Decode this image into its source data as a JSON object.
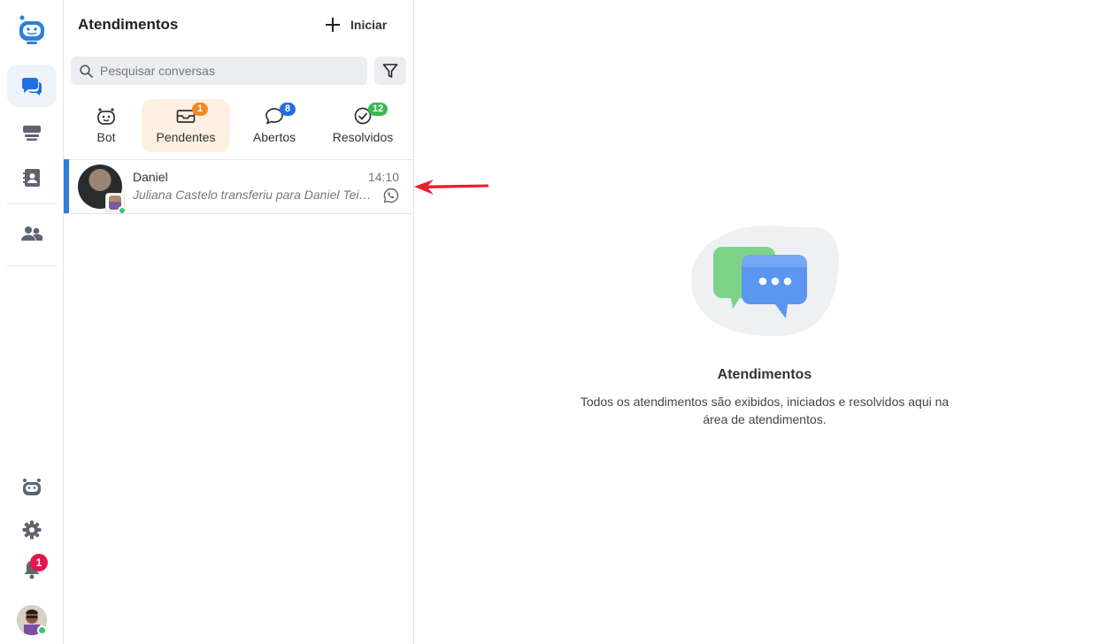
{
  "rail": {
    "items": [
      {
        "name": "bot-logo",
        "icon": "robot-face-icon"
      },
      {
        "name": "chats",
        "icon": "chat-bubbles-icon",
        "active": true
      },
      {
        "name": "queues",
        "icon": "stack-icon"
      },
      {
        "name": "contacts",
        "icon": "contact-book-icon"
      },
      {
        "name": "team",
        "icon": "people-icon"
      },
      {
        "name": "bot-settings",
        "icon": "robot-icon"
      },
      {
        "name": "settings",
        "icon": "gear-icon"
      },
      {
        "name": "notifications",
        "icon": "bell-icon"
      }
    ],
    "notifications_count": "1",
    "accent": "#2d7fdc"
  },
  "panel": {
    "title": "Atendimentos",
    "start_label": "Iniciar",
    "search_placeholder": "Pesquisar conversas"
  },
  "tabs": [
    {
      "label": "Bot",
      "badge": "",
      "icon": "robot-face-icon"
    },
    {
      "label": "Pendentes",
      "badge": "1",
      "badge_color": "#f08a24",
      "icon": "envelope-icon",
      "active": true
    },
    {
      "label": "Abertos",
      "badge": "8",
      "badge_color": "#1f6fe0",
      "icon": "chat-bubble-icon"
    },
    {
      "label": "Resolvidos",
      "badge": "12",
      "badge_color": "#3cb853",
      "icon": "check-circle-icon"
    }
  ],
  "conversations": [
    {
      "name": "Daniel",
      "time": "14:10",
      "preview": "Juliana Castelo transferiu para Daniel Teixeira",
      "channel": "whatsapp-icon"
    }
  ],
  "empty_state": {
    "title": "Atendimentos",
    "description_line1": "Todos os atendimentos são exibidos, iniciados e resolvidos aqui na",
    "description_line2": "área de atendimentos."
  }
}
